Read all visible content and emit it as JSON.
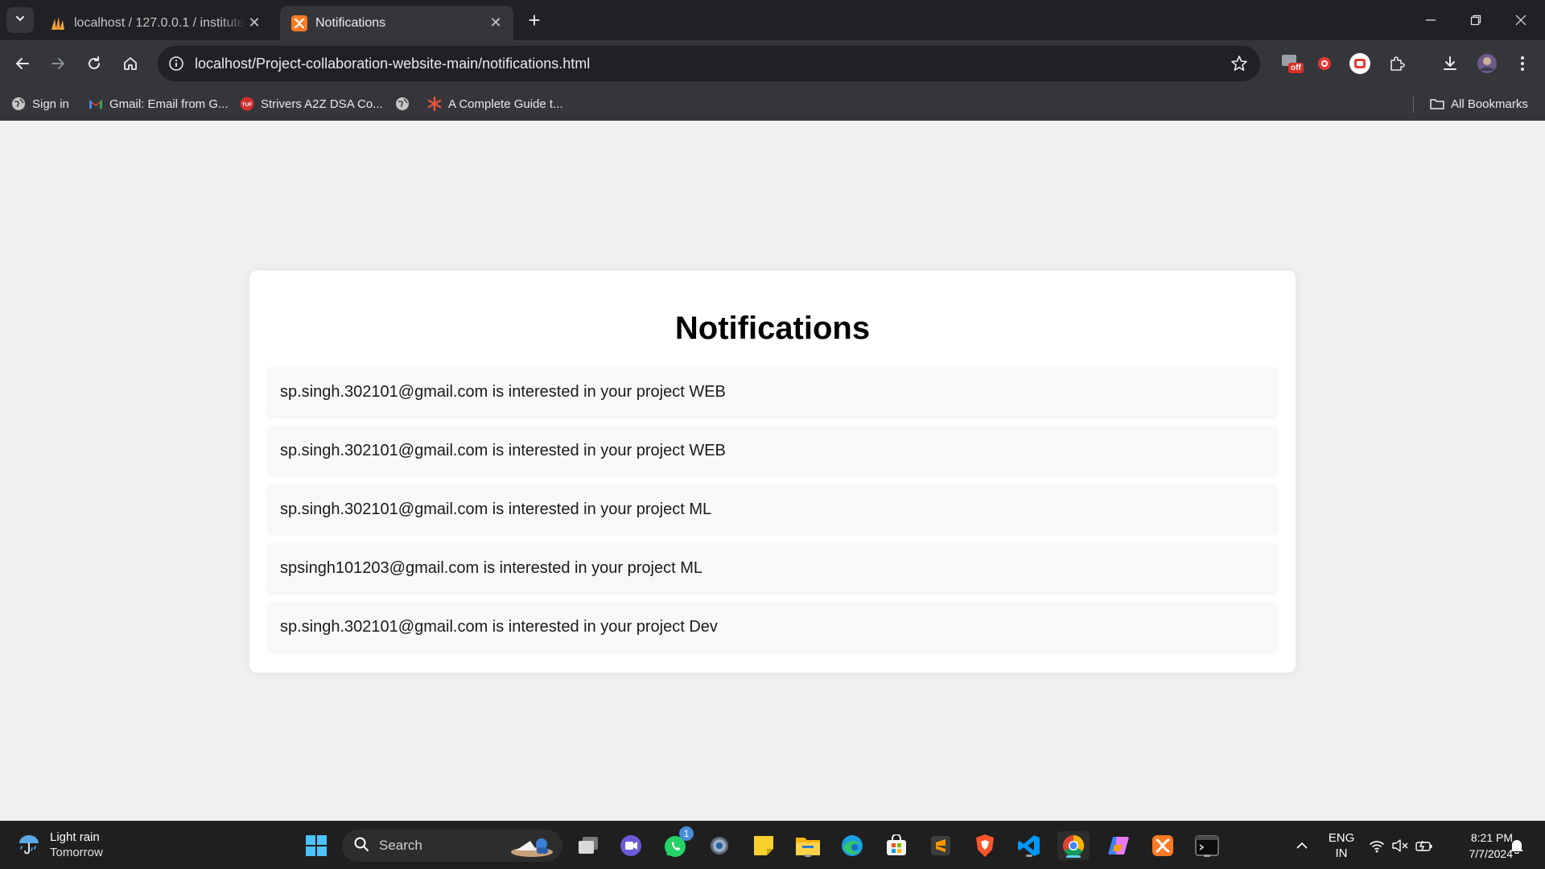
{
  "browser": {
    "tabs": [
      {
        "title": "localhost / 127.0.0.1 / institute_",
        "favicon": "phpmyadmin-icon",
        "active": false
      },
      {
        "title": "Notifications",
        "favicon": "xampp-icon",
        "active": true
      }
    ],
    "address": {
      "url": "localhost/Project-collaboration-website-main/notifications.html"
    },
    "extensions": {
      "badge_text": "off"
    },
    "bookmarks": [
      {
        "label": "Sign in",
        "icon": "globe-icon"
      },
      {
        "label": "Gmail: Email from G...",
        "icon": "gmail-icon"
      },
      {
        "label": "Strivers A2Z DSA Co...",
        "icon": "tuf-icon"
      },
      {
        "label": "",
        "icon": "globe-icon"
      },
      {
        "label": "A Complete Guide t...",
        "icon": "asterisk-icon"
      }
    ],
    "all_bookmarks_label": "All Bookmarks"
  },
  "page": {
    "heading": "Notifications",
    "notifications": [
      "sp.singh.302101@gmail.com is interested in your project WEB",
      "sp.singh.302101@gmail.com is interested in your project WEB",
      "sp.singh.302101@gmail.com is interested in your project ML",
      "spsingh101203@gmail.com is interested in your project ML",
      "sp.singh.302101@gmail.com is interested in your project Dev"
    ]
  },
  "taskbar": {
    "weather": {
      "line1": "Light rain",
      "line2": "Tomorrow"
    },
    "search_label": "Search",
    "whatsapp_badge": "1",
    "language": {
      "line1": "ENG",
      "line2": "IN"
    },
    "clock": {
      "time": "8:21 PM",
      "date": "7/7/2024"
    }
  },
  "colors": {
    "tabstrip": "#202124",
    "toolbar": "#35363a",
    "page_bg": "#f0f0f0",
    "card_bg": "#ffffff",
    "notification_bg": "#f8f8f8",
    "taskbar": "#1f1f1f",
    "accent": "#60cdff"
  }
}
